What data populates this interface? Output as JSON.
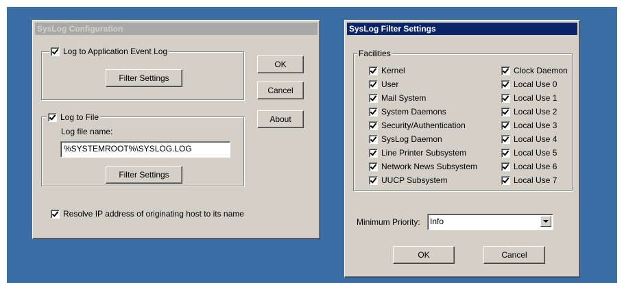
{
  "syslog_config": {
    "title": "SysLog Configuration",
    "event_log_label": "Log to Application Event Log",
    "filter_settings_label": "Filter Settings",
    "log_to_file_label": "Log to File",
    "log_file_name_label": "Log file name:",
    "log_file_name_value": "%SYSTEMROOT%\\SYSLOG.LOG",
    "filter_settings_label_2": "Filter Settings",
    "resolve_ip_label": "Resolve IP address of originating host to its name",
    "ok_label": "OK",
    "cancel_label": "Cancel",
    "about_label": "About"
  },
  "filter_settings": {
    "title": "SysLog Filter Settings",
    "facilities_label": "Facilities",
    "facilities_left": [
      "Kernel",
      "User",
      "Mail System",
      "System Daemons",
      "Security/Authentication",
      "SysLog Daemon",
      "Line Printer Subsystem",
      "Network News Subsystem",
      "UUCP Subsystem"
    ],
    "facilities_right": [
      "Clock Daemon",
      "Local Use 0",
      "Local Use 1",
      "Local Use 2",
      "Local Use 3",
      "Local Use 4",
      "Local Use 5",
      "Local Use 6",
      "Local Use 7"
    ],
    "min_priority_label": "Minimum Priority:",
    "min_priority_value": "Info",
    "ok_label": "OK",
    "cancel_label": "Cancel"
  },
  "colors": {
    "desktop": "#3a6ea5",
    "dialog_face": "#d4d0c8",
    "active_title": "#0a246a",
    "inactive_title": "#a8a8a8"
  }
}
